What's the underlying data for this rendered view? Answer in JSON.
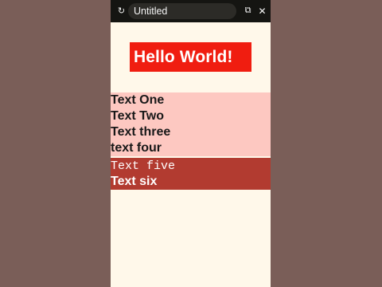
{
  "app": {
    "title": "Untitled"
  },
  "topbar": {
    "reload_icon": "↻",
    "tab_icon": "⧉",
    "close_icon": "✕"
  },
  "content": {
    "hello": "Hello World!",
    "texts": [
      "Text One",
      "Text Two",
      "Text three",
      "text four",
      "Text five",
      "Text six"
    ]
  },
  "colors": {
    "outer_background": "#7a5e58",
    "app_background": "#fff8ea",
    "topbar": "#151512",
    "hello_background": "#f01d10",
    "light_band": "#fdc8c1",
    "dark_band": "#b23b30"
  }
}
